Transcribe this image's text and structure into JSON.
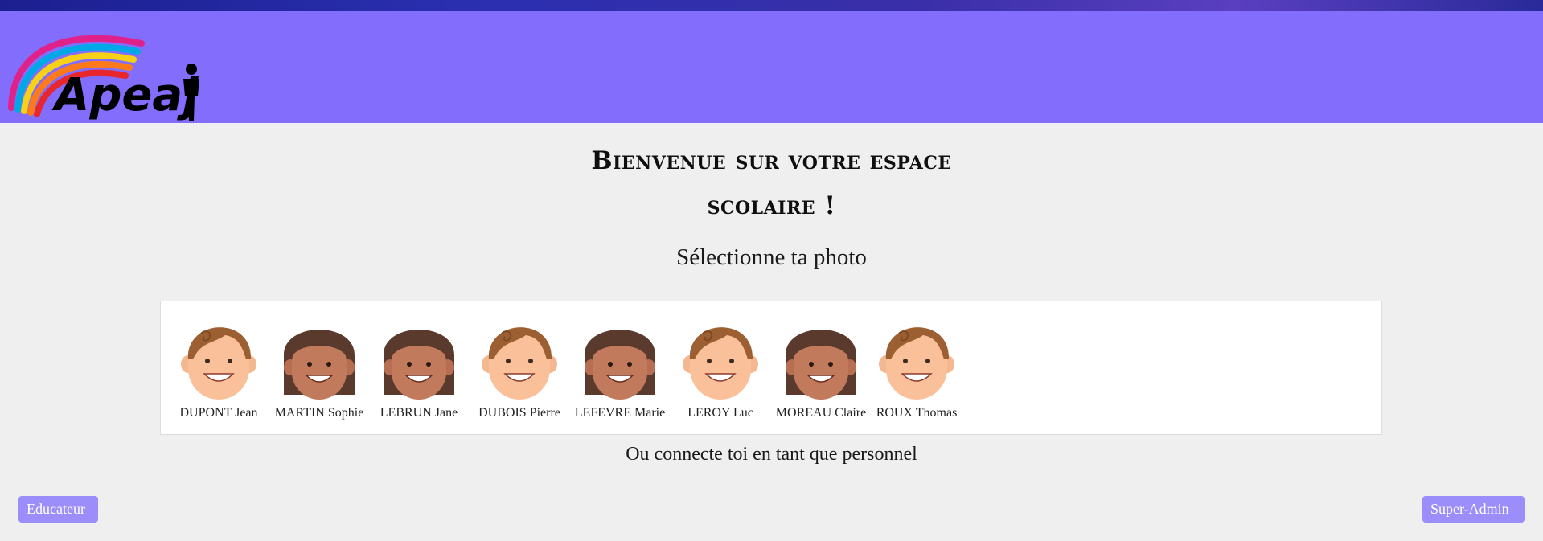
{
  "header": {
    "logo_text": "Apeaj",
    "bg_color": "#836dfc"
  },
  "main": {
    "title_line1": "Bienvenue sur votre espace",
    "title_line2": "scolaire !",
    "subtitle": "Sélectionne ta photo",
    "staff_prompt": "Ou connecte toi en tant que personnel"
  },
  "students": [
    {
      "name": "DUPONT Jean",
      "avatar": "boy-avatar"
    },
    {
      "name": "MARTIN Sophie",
      "avatar": "girl-avatar"
    },
    {
      "name": "LEBRUN Jane",
      "avatar": "girl-avatar"
    },
    {
      "name": "DUBOIS Pierre",
      "avatar": "boy-avatar"
    },
    {
      "name": "LEFEVRE Marie",
      "avatar": "girl-avatar"
    },
    {
      "name": "LEROY Luc",
      "avatar": "boy-avatar"
    },
    {
      "name": "MOREAU Claire",
      "avatar": "girl-avatar"
    },
    {
      "name": "ROUX Thomas",
      "avatar": "boy-avatar"
    }
  ],
  "buttons": {
    "educator_label": "Educateur",
    "superadmin_label": "Super-Admin",
    "color": "#9b8dfa"
  }
}
